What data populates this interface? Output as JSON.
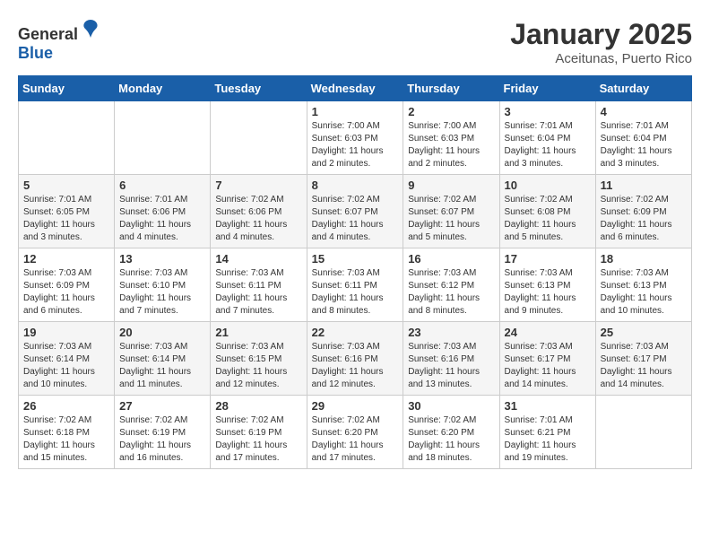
{
  "header": {
    "logo_general": "General",
    "logo_blue": "Blue",
    "month_year": "January 2025",
    "location": "Aceitunas, Puerto Rico"
  },
  "weekdays": [
    "Sunday",
    "Monday",
    "Tuesday",
    "Wednesday",
    "Thursday",
    "Friday",
    "Saturday"
  ],
  "weeks": [
    [
      {
        "day": "",
        "info": ""
      },
      {
        "day": "",
        "info": ""
      },
      {
        "day": "",
        "info": ""
      },
      {
        "day": "1",
        "info": "Sunrise: 7:00 AM\nSunset: 6:03 PM\nDaylight: 11 hours\nand 2 minutes."
      },
      {
        "day": "2",
        "info": "Sunrise: 7:00 AM\nSunset: 6:03 PM\nDaylight: 11 hours\nand 2 minutes."
      },
      {
        "day": "3",
        "info": "Sunrise: 7:01 AM\nSunset: 6:04 PM\nDaylight: 11 hours\nand 3 minutes."
      },
      {
        "day": "4",
        "info": "Sunrise: 7:01 AM\nSunset: 6:04 PM\nDaylight: 11 hours\nand 3 minutes."
      }
    ],
    [
      {
        "day": "5",
        "info": "Sunrise: 7:01 AM\nSunset: 6:05 PM\nDaylight: 11 hours\nand 3 minutes."
      },
      {
        "day": "6",
        "info": "Sunrise: 7:01 AM\nSunset: 6:06 PM\nDaylight: 11 hours\nand 4 minutes."
      },
      {
        "day": "7",
        "info": "Sunrise: 7:02 AM\nSunset: 6:06 PM\nDaylight: 11 hours\nand 4 minutes."
      },
      {
        "day": "8",
        "info": "Sunrise: 7:02 AM\nSunset: 6:07 PM\nDaylight: 11 hours\nand 4 minutes."
      },
      {
        "day": "9",
        "info": "Sunrise: 7:02 AM\nSunset: 6:07 PM\nDaylight: 11 hours\nand 5 minutes."
      },
      {
        "day": "10",
        "info": "Sunrise: 7:02 AM\nSunset: 6:08 PM\nDaylight: 11 hours\nand 5 minutes."
      },
      {
        "day": "11",
        "info": "Sunrise: 7:02 AM\nSunset: 6:09 PM\nDaylight: 11 hours\nand 6 minutes."
      }
    ],
    [
      {
        "day": "12",
        "info": "Sunrise: 7:03 AM\nSunset: 6:09 PM\nDaylight: 11 hours\nand 6 minutes."
      },
      {
        "day": "13",
        "info": "Sunrise: 7:03 AM\nSunset: 6:10 PM\nDaylight: 11 hours\nand 7 minutes."
      },
      {
        "day": "14",
        "info": "Sunrise: 7:03 AM\nSunset: 6:11 PM\nDaylight: 11 hours\nand 7 minutes."
      },
      {
        "day": "15",
        "info": "Sunrise: 7:03 AM\nSunset: 6:11 PM\nDaylight: 11 hours\nand 8 minutes."
      },
      {
        "day": "16",
        "info": "Sunrise: 7:03 AM\nSunset: 6:12 PM\nDaylight: 11 hours\nand 8 minutes."
      },
      {
        "day": "17",
        "info": "Sunrise: 7:03 AM\nSunset: 6:13 PM\nDaylight: 11 hours\nand 9 minutes."
      },
      {
        "day": "18",
        "info": "Sunrise: 7:03 AM\nSunset: 6:13 PM\nDaylight: 11 hours\nand 10 minutes."
      }
    ],
    [
      {
        "day": "19",
        "info": "Sunrise: 7:03 AM\nSunset: 6:14 PM\nDaylight: 11 hours\nand 10 minutes."
      },
      {
        "day": "20",
        "info": "Sunrise: 7:03 AM\nSunset: 6:14 PM\nDaylight: 11 hours\nand 11 minutes."
      },
      {
        "day": "21",
        "info": "Sunrise: 7:03 AM\nSunset: 6:15 PM\nDaylight: 11 hours\nand 12 minutes."
      },
      {
        "day": "22",
        "info": "Sunrise: 7:03 AM\nSunset: 6:16 PM\nDaylight: 11 hours\nand 12 minutes."
      },
      {
        "day": "23",
        "info": "Sunrise: 7:03 AM\nSunset: 6:16 PM\nDaylight: 11 hours\nand 13 minutes."
      },
      {
        "day": "24",
        "info": "Sunrise: 7:03 AM\nSunset: 6:17 PM\nDaylight: 11 hours\nand 14 minutes."
      },
      {
        "day": "25",
        "info": "Sunrise: 7:03 AM\nSunset: 6:17 PM\nDaylight: 11 hours\nand 14 minutes."
      }
    ],
    [
      {
        "day": "26",
        "info": "Sunrise: 7:02 AM\nSunset: 6:18 PM\nDaylight: 11 hours\nand 15 minutes."
      },
      {
        "day": "27",
        "info": "Sunrise: 7:02 AM\nSunset: 6:19 PM\nDaylight: 11 hours\nand 16 minutes."
      },
      {
        "day": "28",
        "info": "Sunrise: 7:02 AM\nSunset: 6:19 PM\nDaylight: 11 hours\nand 17 minutes."
      },
      {
        "day": "29",
        "info": "Sunrise: 7:02 AM\nSunset: 6:20 PM\nDaylight: 11 hours\nand 17 minutes."
      },
      {
        "day": "30",
        "info": "Sunrise: 7:02 AM\nSunset: 6:20 PM\nDaylight: 11 hours\nand 18 minutes."
      },
      {
        "day": "31",
        "info": "Sunrise: 7:01 AM\nSunset: 6:21 PM\nDaylight: 11 hours\nand 19 minutes."
      },
      {
        "day": "",
        "info": ""
      }
    ]
  ]
}
